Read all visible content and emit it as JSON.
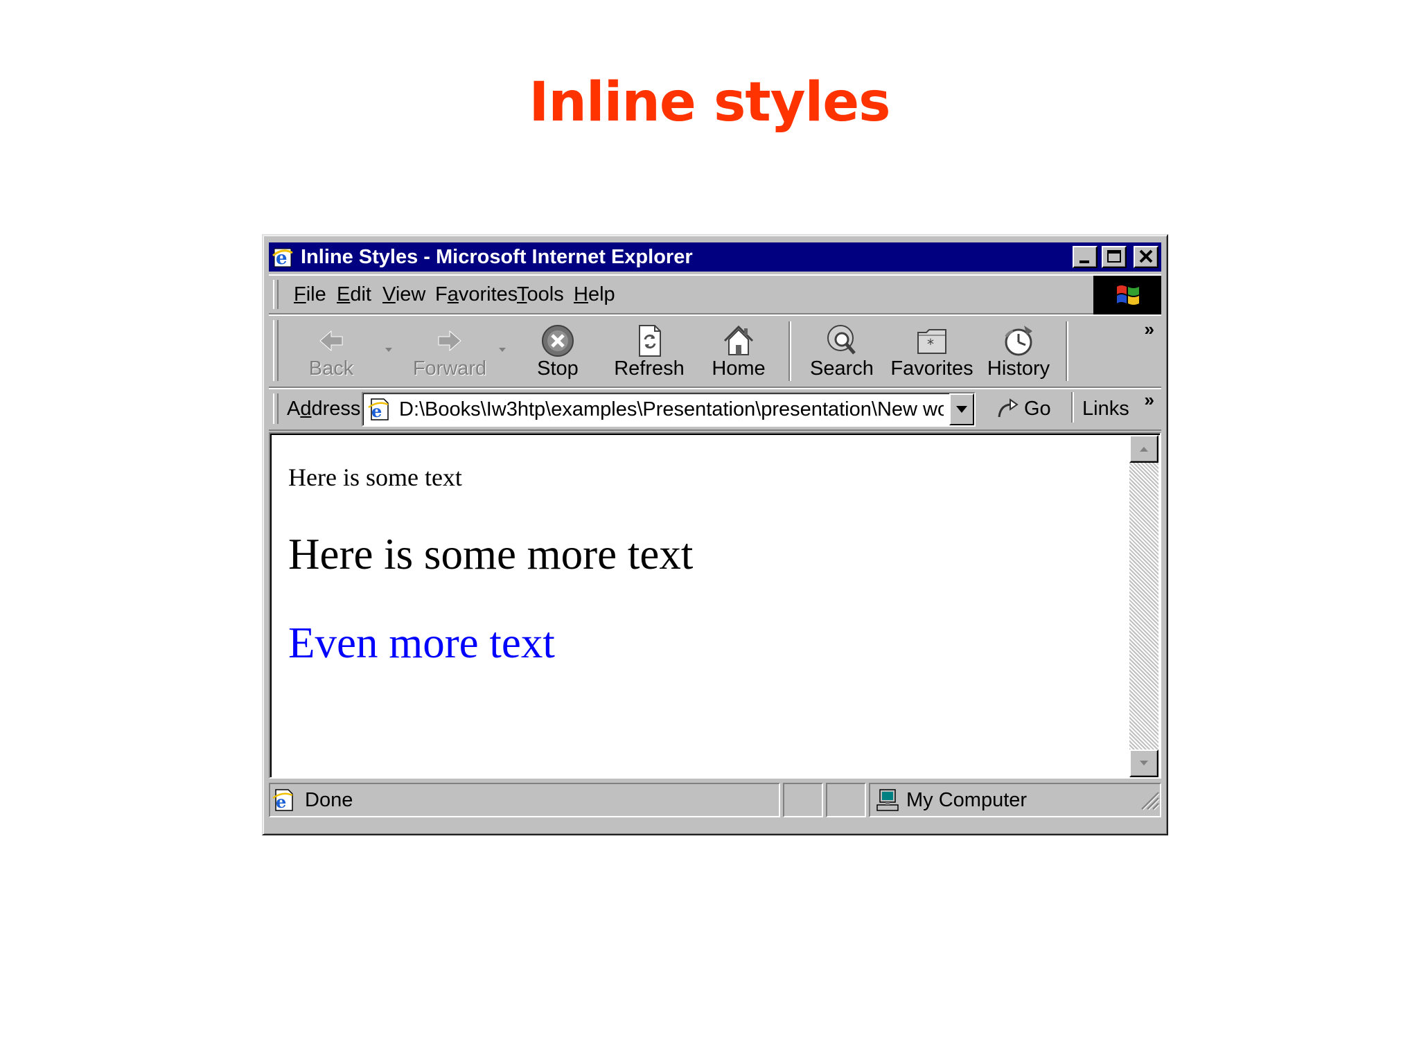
{
  "slide": {
    "title": "Inline styles",
    "title_color": "#ff3300"
  },
  "window": {
    "title": "Inline Styles - Microsoft Internet Explorer",
    "app_icon": "ie-logo-icon",
    "controls": [
      "minimize-icon",
      "maximize-icon",
      "close-icon"
    ]
  },
  "menu": {
    "items": [
      {
        "accel": "F",
        "rest": "ile"
      },
      {
        "accel": "E",
        "rest": "dit"
      },
      {
        "accel": "V",
        "rest": "iew"
      },
      {
        "pre": "F",
        "accel": "a",
        "rest": "vorites"
      },
      {
        "accel": "T",
        "rest": "ools"
      },
      {
        "accel": "H",
        "rest": "elp"
      }
    ],
    "throbber_icon": "windows-flag-icon"
  },
  "toolbar": {
    "back": "Back",
    "forward": "Forward",
    "stop": "Stop",
    "refresh": "Refresh",
    "home": "Home",
    "search": "Search",
    "favorites": "Favorites",
    "history": "History",
    "more": "»"
  },
  "address": {
    "label_pre": "A",
    "label_accel": "d",
    "label_rest": "dress",
    "url": "D:\\Books\\Iw3htp\\examples\\Presentation\\presentation\\New wo",
    "go": "Go",
    "links": "Links",
    "links_more": "»"
  },
  "content": {
    "p1": "Here is some text",
    "p2": "Here is some more text",
    "p3": "Even more text",
    "p3_color": "#0000ff"
  },
  "status": {
    "text": "Done",
    "zone": "My Computer"
  }
}
